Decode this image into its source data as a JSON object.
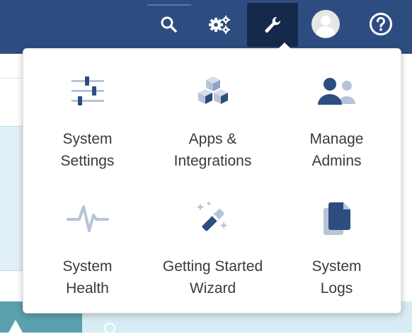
{
  "topbar": {
    "icons": [
      {
        "name": "search-icon"
      },
      {
        "name": "gears-icon"
      },
      {
        "name": "wrench-icon",
        "active": true
      },
      {
        "name": "avatar-icon"
      },
      {
        "name": "help-icon"
      }
    ]
  },
  "dropdown": {
    "items": [
      {
        "icon": "sliders-icon",
        "label": "System\nSettings"
      },
      {
        "icon": "cubes-icon",
        "label": "Apps &\nIntegrations"
      },
      {
        "icon": "users-icon",
        "label": "Manage\nAdmins"
      },
      {
        "icon": "heartbeat-icon",
        "label": "System\nHealth"
      },
      {
        "icon": "magic-wand-icon",
        "label": "Getting Started\nWizard"
      },
      {
        "icon": "documents-icon",
        "label": "System\nLogs"
      }
    ]
  },
  "colors": {
    "topbar": "#2d4d80",
    "active": "#15294a",
    "icon_dark": "#2d4d80",
    "icon_light": "#b7c4d8",
    "text": "#3a3a3a"
  }
}
